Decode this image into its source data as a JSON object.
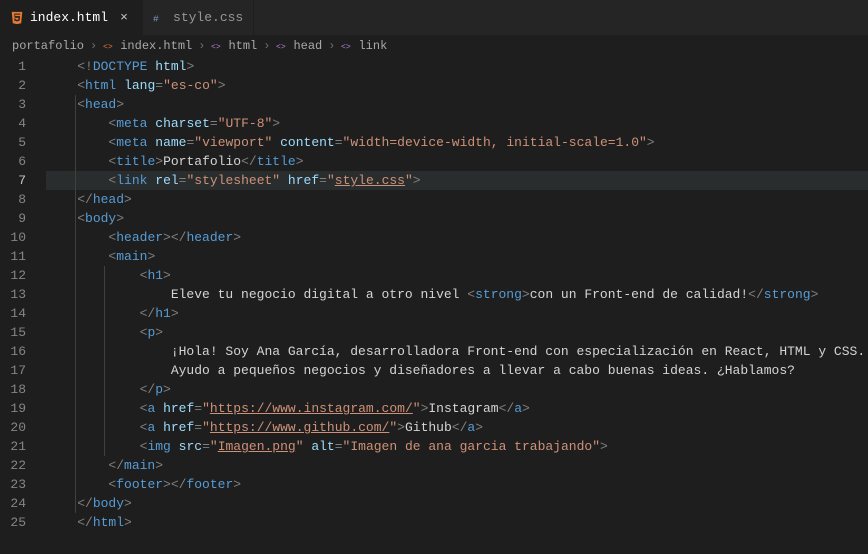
{
  "tabs": [
    {
      "label": "index.html",
      "icon": "html",
      "active": true,
      "closeVisible": true
    },
    {
      "label": "style.css",
      "icon": "css",
      "active": false,
      "closeVisible": false
    }
  ],
  "breadcrumbs": [
    {
      "label": "portafolio",
      "icon": null
    },
    {
      "label": "index.html",
      "icon": "html"
    },
    {
      "label": "html",
      "icon": "symbol"
    },
    {
      "label": "head",
      "icon": "symbol"
    },
    {
      "label": "link",
      "icon": "symbol"
    }
  ],
  "activeLine": 7,
  "code": {
    "l1": [
      [
        "<!",
        "punc"
      ],
      [
        "DOCTYPE",
        "tag"
      ],
      [
        " ",
        "txt"
      ],
      [
        "html",
        "attr"
      ],
      [
        ">",
        "punc"
      ]
    ],
    "l2": [
      [
        "<",
        "punc"
      ],
      [
        "html",
        "tag"
      ],
      [
        " ",
        "txt"
      ],
      [
        "lang",
        "attr"
      ],
      [
        "=",
        "punc"
      ],
      [
        "\"es-co\"",
        "str"
      ],
      [
        ">",
        "punc"
      ]
    ],
    "l3": [
      [
        "<",
        "punc"
      ],
      [
        "head",
        "tag"
      ],
      [
        ">",
        "punc"
      ]
    ],
    "l4": [
      [
        "<",
        "punc"
      ],
      [
        "meta",
        "tag"
      ],
      [
        " ",
        "txt"
      ],
      [
        "charset",
        "attr"
      ],
      [
        "=",
        "punc"
      ],
      [
        "\"UTF-8\"",
        "str"
      ],
      [
        ">",
        "punc"
      ]
    ],
    "l5": [
      [
        "<",
        "punc"
      ],
      [
        "meta",
        "tag"
      ],
      [
        " ",
        "txt"
      ],
      [
        "name",
        "attr"
      ],
      [
        "=",
        "punc"
      ],
      [
        "\"viewport\"",
        "str"
      ],
      [
        " ",
        "txt"
      ],
      [
        "content",
        "attr"
      ],
      [
        "=",
        "punc"
      ],
      [
        "\"width=device-width, initial-scale=1.0\"",
        "str"
      ],
      [
        ">",
        "punc"
      ]
    ],
    "l6": [
      [
        "<",
        "punc"
      ],
      [
        "title",
        "tag"
      ],
      [
        ">",
        "punc"
      ],
      [
        "Portafolio",
        "txt"
      ],
      [
        "</",
        "punc"
      ],
      [
        "title",
        "tag"
      ],
      [
        ">",
        "punc"
      ]
    ],
    "l7": [
      [
        "<",
        "punc"
      ],
      [
        "link",
        "tag"
      ],
      [
        " ",
        "txt"
      ],
      [
        "rel",
        "attr"
      ],
      [
        "=",
        "punc"
      ],
      [
        "\"stylesheet\"",
        "str"
      ],
      [
        " ",
        "txt"
      ],
      [
        "href",
        "attr"
      ],
      [
        "=",
        "punc"
      ],
      [
        "\"",
        "str"
      ],
      [
        "style.css",
        "str",
        "u"
      ],
      [
        "\"",
        "str"
      ],
      [
        ">",
        "punc"
      ]
    ],
    "l8": [
      [
        "</",
        "punc"
      ],
      [
        "head",
        "tag"
      ],
      [
        ">",
        "punc"
      ]
    ],
    "l9": [
      [
        "<",
        "punc"
      ],
      [
        "body",
        "tag"
      ],
      [
        ">",
        "punc"
      ]
    ],
    "l10": [
      [
        "<",
        "punc"
      ],
      [
        "header",
        "tag"
      ],
      [
        "></",
        "punc"
      ],
      [
        "header",
        "tag"
      ],
      [
        ">",
        "punc"
      ]
    ],
    "l11": [
      [
        "<",
        "punc"
      ],
      [
        "main",
        "tag"
      ],
      [
        ">",
        "punc"
      ]
    ],
    "l12": [
      [
        "<",
        "punc"
      ],
      [
        "h1",
        "tag"
      ],
      [
        ">",
        "punc"
      ]
    ],
    "l13": [
      [
        "Eleve tu negocio digital a otro nivel ",
        "txt"
      ],
      [
        "<",
        "punc"
      ],
      [
        "strong",
        "tag"
      ],
      [
        ">",
        "punc"
      ],
      [
        "con un Front-end de calidad!",
        "txt"
      ],
      [
        "</",
        "punc"
      ],
      [
        "strong",
        "tag"
      ],
      [
        ">",
        "punc"
      ]
    ],
    "l14": [
      [
        "</",
        "punc"
      ],
      [
        "h1",
        "tag"
      ],
      [
        ">",
        "punc"
      ]
    ],
    "l15": [
      [
        "<",
        "punc"
      ],
      [
        "p",
        "tag"
      ],
      [
        ">",
        "punc"
      ]
    ],
    "l16": [
      [
        "¡Hola! Soy Ana García, desarrolladora Front-end con especialización en React, HTML y CSS.",
        "txt"
      ]
    ],
    "l17": [
      [
        "Ayudo a pequeños negocios y diseñadores a llevar a cabo buenas ideas. ¿Hablamos?",
        "txt"
      ]
    ],
    "l18": [
      [
        "</",
        "punc"
      ],
      [
        "p",
        "tag"
      ],
      [
        ">",
        "punc"
      ]
    ],
    "l19": [
      [
        "<",
        "punc"
      ],
      [
        "a",
        "tag"
      ],
      [
        " ",
        "txt"
      ],
      [
        "href",
        "attr"
      ],
      [
        "=",
        "punc"
      ],
      [
        "\"",
        "str"
      ],
      [
        "https://www.instagram.com/",
        "str",
        "u"
      ],
      [
        "\"",
        "str"
      ],
      [
        ">",
        "punc"
      ],
      [
        "Instagram",
        "txt"
      ],
      [
        "</",
        "punc"
      ],
      [
        "a",
        "tag"
      ],
      [
        ">",
        "punc"
      ]
    ],
    "l20": [
      [
        "<",
        "punc"
      ],
      [
        "a",
        "tag"
      ],
      [
        " ",
        "txt"
      ],
      [
        "href",
        "attr"
      ],
      [
        "=",
        "punc"
      ],
      [
        "\"",
        "str"
      ],
      [
        "https://www.github.com/",
        "str",
        "u"
      ],
      [
        "\"",
        "str"
      ],
      [
        ">",
        "punc"
      ],
      [
        "Github",
        "txt"
      ],
      [
        "</",
        "punc"
      ],
      [
        "a",
        "tag"
      ],
      [
        ">",
        "punc"
      ]
    ],
    "l21": [
      [
        "<",
        "punc"
      ],
      [
        "img",
        "tag"
      ],
      [
        " ",
        "txt"
      ],
      [
        "src",
        "attr"
      ],
      [
        "=",
        "punc"
      ],
      [
        "\"",
        "str"
      ],
      [
        "Imagen.png",
        "str",
        "u"
      ],
      [
        "\"",
        "str"
      ],
      [
        " ",
        "txt"
      ],
      [
        "alt",
        "attr"
      ],
      [
        "=",
        "punc"
      ],
      [
        "\"Imagen de ana garcia trabajando\"",
        "str"
      ],
      [
        ">",
        "punc"
      ]
    ],
    "l22": [
      [
        "</",
        "punc"
      ],
      [
        "main",
        "tag"
      ],
      [
        ">",
        "punc"
      ]
    ],
    "l23": [
      [
        "<",
        "punc"
      ],
      [
        "footer",
        "tag"
      ],
      [
        "></",
        "punc"
      ],
      [
        "footer",
        "tag"
      ],
      [
        ">",
        "punc"
      ]
    ],
    "l24": [
      [
        "</",
        "punc"
      ],
      [
        "body",
        "tag"
      ],
      [
        ">",
        "punc"
      ]
    ],
    "l25": [
      [
        "</",
        "punc"
      ],
      [
        "html",
        "tag"
      ],
      [
        ">",
        "punc"
      ]
    ]
  },
  "indent": {
    "l1": 0,
    "l2": 0,
    "l3": 0,
    "l4": 1,
    "l5": 1,
    "l6": 1,
    "l7": 1,
    "l8": 0,
    "l9": 0,
    "l10": 1,
    "l11": 1,
    "l12": 2,
    "l13": 3,
    "l14": 2,
    "l15": 2,
    "l16": 3,
    "l17": 3,
    "l18": 2,
    "l19": 2,
    "l20": 2,
    "l21": 2,
    "l22": 1,
    "l23": 1,
    "l24": 0,
    "l25": 0
  },
  "guides": {
    "l1": 0,
    "l2": 0,
    "l3": 1,
    "l4": 1,
    "l5": 1,
    "l6": 1,
    "l7": 1,
    "l8": 1,
    "l9": 1,
    "l10": 1,
    "l11": 1,
    "l12": 2,
    "l13": 2,
    "l14": 2,
    "l15": 2,
    "l16": 2,
    "l17": 2,
    "l18": 2,
    "l19": 2,
    "l20": 2,
    "l21": 2,
    "l22": 1,
    "l23": 1,
    "l24": 1,
    "l25": 0
  }
}
